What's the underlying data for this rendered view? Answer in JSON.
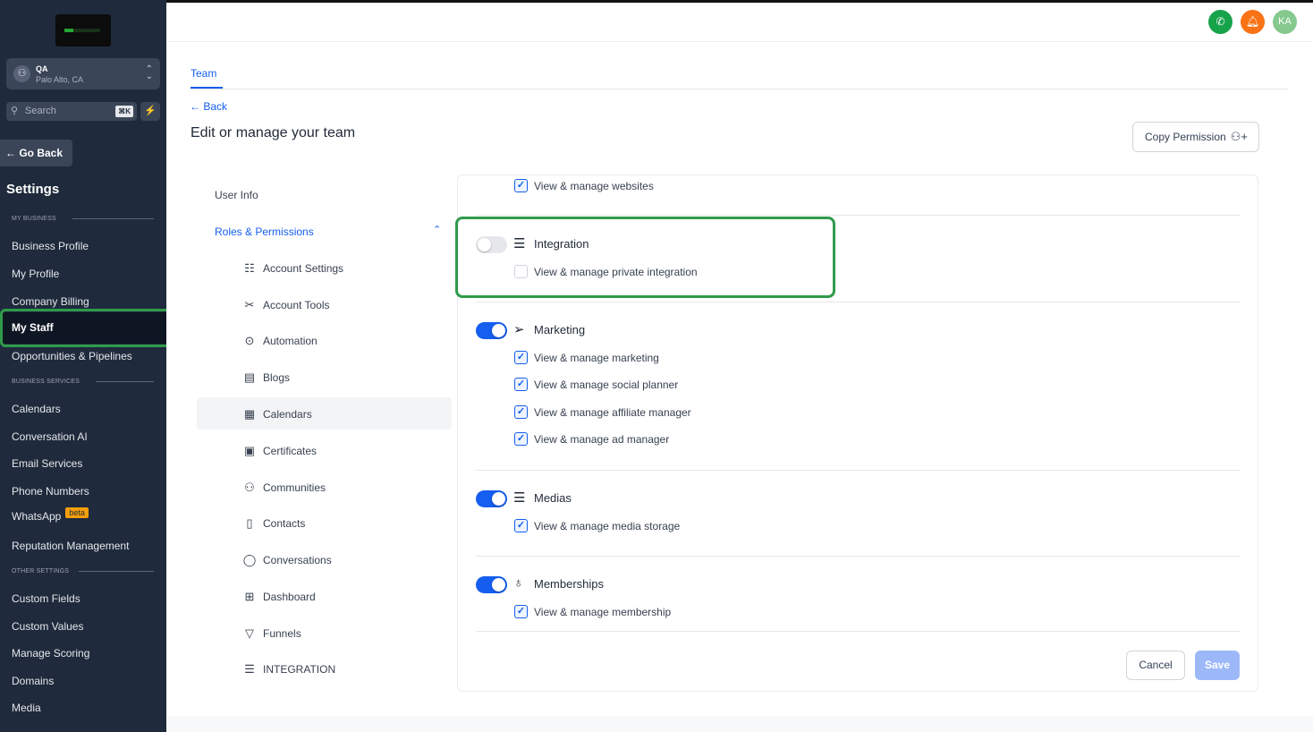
{
  "sidebar": {
    "location": {
      "name": "QA",
      "address": "Palo Alto, CA"
    },
    "search": {
      "placeholder": "Search",
      "shortcut": "⌘K"
    },
    "go_back": "← Go Back",
    "title": "Settings",
    "sections": {
      "my_business": "MY BUSINESS",
      "business_services": "BUSINESS SERVICES",
      "other_settings": "OTHER SETTINGS"
    },
    "items": {
      "business_profile": "Business Profile",
      "my_profile": "My Profile",
      "company_billing": "Company Billing",
      "my_staff": "My Staff",
      "opportunities": "Opportunities & Pipelines",
      "calendars": "Calendars",
      "conversation_ai": "Conversation AI",
      "email_services": "Email Services",
      "phone_numbers": "Phone Numbers",
      "whatsapp": "WhatsApp",
      "whatsapp_badge": "beta",
      "reputation": "Reputation Management",
      "custom_fields": "Custom Fields",
      "custom_values": "Custom Values",
      "manage_scoring": "Manage Scoring",
      "domains": "Domains",
      "media": "Media"
    }
  },
  "topbar": {
    "avatar_initials": "KA"
  },
  "main": {
    "tab": "Team",
    "back": "← Back",
    "title": "Edit or manage your team",
    "copy_permission": "Copy Permission",
    "left_nav": {
      "user_info": "User Info",
      "roles_permissions": "Roles & Permissions",
      "items": [
        "Account Settings",
        "Account Tools",
        "Automation",
        "Blogs",
        "Calendars",
        "Certificates",
        "Communities",
        "Contacts",
        "Conversations",
        "Dashboard",
        "Funnels",
        "INTEGRATION"
      ]
    },
    "permissions": {
      "websites": {
        "label": "View & manage websites",
        "checked": true
      },
      "integration": {
        "title": "Integration",
        "enabled": false,
        "items": [
          "View & manage private integration"
        ],
        "checked": [
          false
        ]
      },
      "marketing": {
        "title": "Marketing",
        "enabled": true,
        "items": [
          "View & manage marketing",
          "View & manage social planner",
          "View & manage affiliate manager",
          "View & manage ad manager"
        ]
      },
      "medias": {
        "title": "Medias",
        "enabled": true,
        "items": [
          "View & manage media storage"
        ]
      },
      "memberships": {
        "title": "Memberships",
        "enabled": true,
        "items": [
          "View & manage membership"
        ]
      }
    },
    "cancel": "Cancel",
    "save": "Save"
  },
  "colors": {
    "sidebar_bg": "#1f2a3c",
    "accent": "#155eef",
    "highlight": "#2f9b4a"
  }
}
